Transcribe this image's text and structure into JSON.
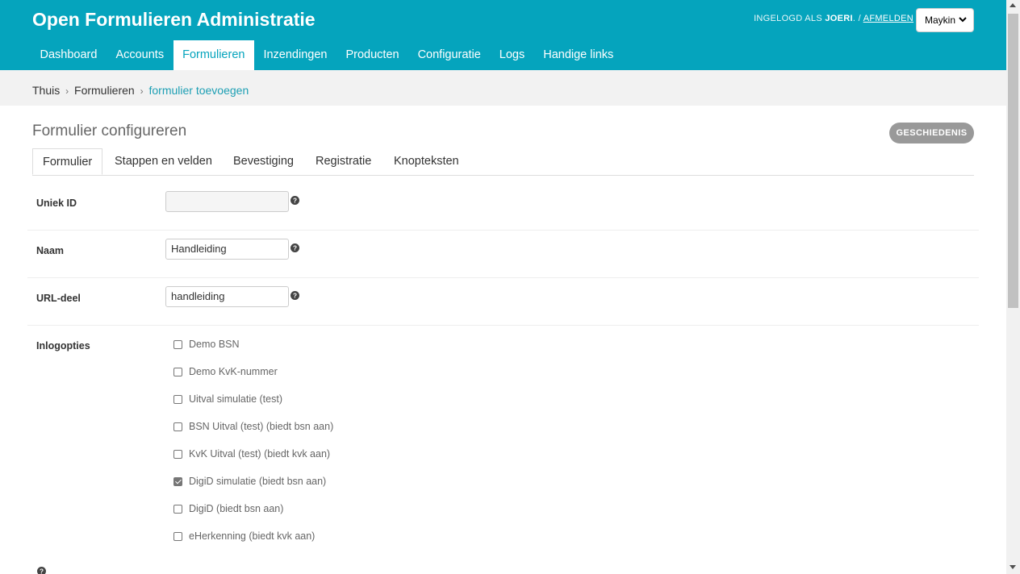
{
  "header": {
    "site_title": "Open Formulieren Administratie",
    "logged_in_prefix": "INGELOGD ALS",
    "username": "JOERI",
    "separator": ". /",
    "logout_label": "AFMELDEN",
    "org_selected": "Maykin"
  },
  "nav": {
    "items": [
      {
        "label": "Dashboard"
      },
      {
        "label": "Accounts"
      },
      {
        "label": "Formulieren"
      },
      {
        "label": "Inzendingen"
      },
      {
        "label": "Producten"
      },
      {
        "label": "Configuratie"
      },
      {
        "label": "Logs"
      },
      {
        "label": "Handige links"
      }
    ],
    "active": "Formulieren"
  },
  "breadcrumbs": {
    "items": [
      "Thuis",
      "Formulieren",
      "formulier toevoegen"
    ],
    "separator": "›"
  },
  "main": {
    "title": "Formulier configureren",
    "history_button": "GESCHIEDENIS",
    "tabs": [
      {
        "label": "Formulier"
      },
      {
        "label": "Stappen en velden"
      },
      {
        "label": "Bevestiging"
      },
      {
        "label": "Registratie"
      },
      {
        "label": "Knopteksten"
      }
    ],
    "active_tab": "Formulier"
  },
  "form": {
    "unique_id": {
      "label": "Uniek ID",
      "value": ""
    },
    "name": {
      "label": "Naam",
      "value": "Handleiding"
    },
    "slug": {
      "label": "URL-deel",
      "value": "handleiding"
    },
    "login_options": {
      "label": "Inlogopties",
      "options": [
        {
          "label": "Demo BSN",
          "checked": false
        },
        {
          "label": "Demo KvK-nummer",
          "checked": false
        },
        {
          "label": "Uitval simulatie (test)",
          "checked": false
        },
        {
          "label": "BSN Uitval (test) (biedt bsn aan)",
          "checked": false
        },
        {
          "label": "KvK Uitval (test) (biedt kvk aan)",
          "checked": false
        },
        {
          "label": "DigiD simulatie (biedt bsn aan)",
          "checked": true
        },
        {
          "label": "DigiD (biedt bsn aan)",
          "checked": false
        },
        {
          "label": "eHerkenning (biedt kvk aan)",
          "checked": false
        }
      ]
    }
  },
  "colors": {
    "brand": "#05a4bd",
    "breadcrumb_bg": "#f2f2f2",
    "history_button": "#999999"
  },
  "icons": {
    "help": "question-circle-icon",
    "select_chevron": "chevron-down-icon"
  }
}
